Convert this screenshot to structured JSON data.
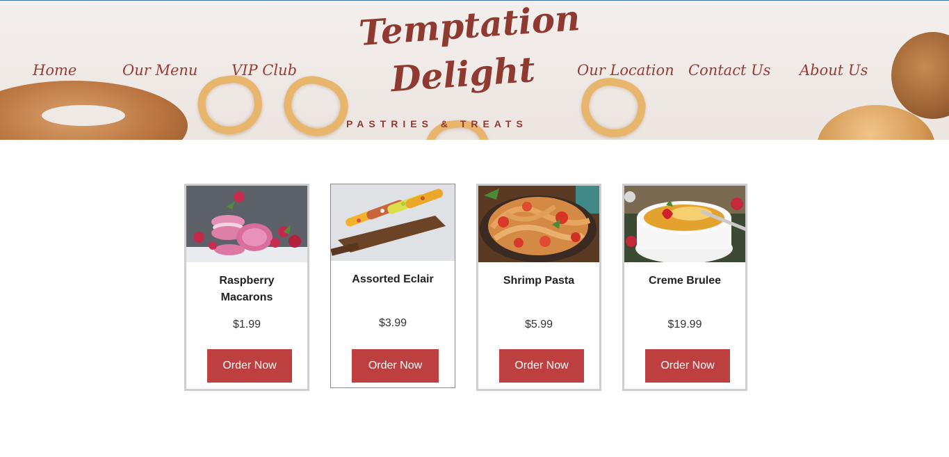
{
  "header": {
    "nav_left": [
      "Home",
      "Our Menu",
      "VIP Club"
    ],
    "nav_right": [
      "Our Location",
      "Contact Us",
      "About Us"
    ],
    "logo": {
      "line1": "Temptation",
      "line2": "Delight",
      "tagline": "PASTRIES & TREATS"
    }
  },
  "products": [
    {
      "name": "Raspberry Macarons",
      "price": "$1.99",
      "button": "Order Now",
      "image_icon": "macarons-image"
    },
    {
      "name": "Assorted Eclair",
      "price": "$3.99",
      "button": "Order Now",
      "image_icon": "eclair-image"
    },
    {
      "name": "Shrimp Pasta",
      "price": "$5.99",
      "button": "Order Now",
      "image_icon": "pasta-image"
    },
    {
      "name": "Creme Brulee",
      "price": "$19.99",
      "button": "Order Now",
      "image_icon": "creme-brulee-image"
    }
  ],
  "colors": {
    "brand": "#9a3b33",
    "button": "#bd3f3f",
    "card_border": "#cfcfcf"
  }
}
